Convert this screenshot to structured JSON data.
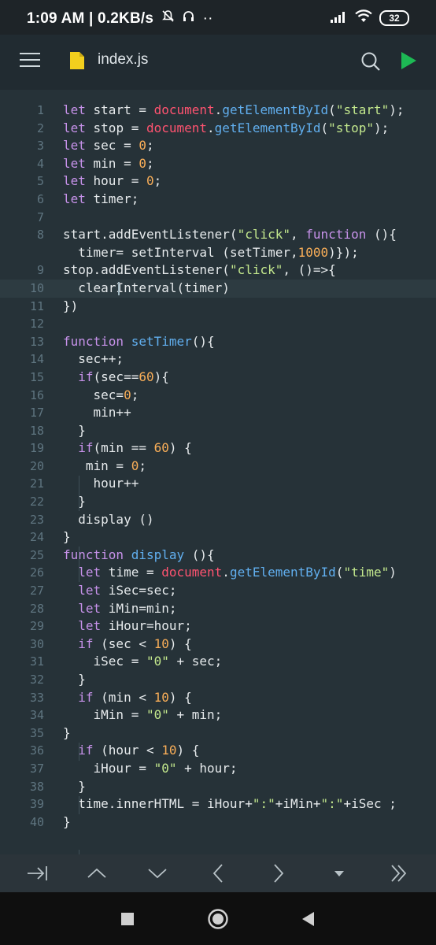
{
  "status_bar": {
    "time": "1:09 AM",
    "speed": "0.2KB/s",
    "battery": "32",
    "icons": [
      "muted-bell-icon",
      "headphones-icon",
      "more-dots-icon",
      "signal-icon",
      "wifi-icon",
      "battery-icon"
    ]
  },
  "app_bar": {
    "filename": "index.js",
    "icons": [
      "menu-icon",
      "js-file-icon",
      "search-icon",
      "run-icon"
    ]
  },
  "editor": {
    "active_line": 10,
    "line_numbers": [
      "1",
      "2",
      "3",
      "4",
      "5",
      "6",
      "7",
      "8",
      "",
      "9",
      "10",
      "11",
      "12",
      "13",
      "14",
      "15",
      "16",
      "17",
      "18",
      "19",
      "20",
      "21",
      "22",
      "23",
      "24",
      "25",
      "26",
      "27",
      "28",
      "29",
      "30",
      "31",
      "32",
      "33",
      "34",
      "35",
      "36",
      "37",
      "38",
      "39",
      "40"
    ],
    "lines": [
      "let start = document.getElementById(\"start\");",
      "let stop = document.getElementById(\"stop\");",
      "let sec = 0;",
      "let min = 0;",
      "let hour = 0;",
      "let timer;",
      "",
      "start.addEventListener(\"click\", function (){",
      "  timer= setInterval (setTimer,1000)});",
      "stop.addEventListener(\"click\", ()=>{",
      "  clearInterval(timer)",
      "})",
      "",
      "function setTimer(){",
      "  sec++;",
      "  if(sec==60){",
      "    sec=0;",
      "    min++",
      "  }",
      "  if(min == 60) {",
      "   min = 0;",
      "    hour++",
      "  }",
      "  display ()",
      "}",
      "function display (){",
      "  let time = document.getElementById(\"time\")",
      "  let iSec=sec;",
      "  let iMin=min;",
      "  let iHour=hour;",
      "  if (sec < 10) {",
      "    iSec = \"0\" + sec;",
      "  }",
      "  if (min < 10) {",
      "    iMin = \"0\" + min;",
      "}",
      "  if (hour < 10) {",
      "    iHour = \"0\" + hour;",
      "  }",
      "  time.innerHTML = iHour+\":\"+iMin+\":\"+iSec ;",
      "}"
    ]
  },
  "keyboard_bar": {
    "keys": [
      {
        "name": "tab-key",
        "icon": "tab-arrow-icon"
      },
      {
        "name": "up-key",
        "icon": "chevron-up-icon"
      },
      {
        "name": "down-key",
        "icon": "chevron-down-icon"
      },
      {
        "name": "left-key",
        "icon": "chevron-left-icon"
      },
      {
        "name": "right-key",
        "icon": "chevron-right-icon"
      },
      {
        "name": "dropdown-key",
        "icon": "caret-down-icon"
      },
      {
        "name": "end-key",
        "icon": "double-chevron-right-icon"
      }
    ]
  },
  "nav_bar": {
    "buttons": [
      "recents-square-icon",
      "home-circle-icon",
      "back-triangle-icon"
    ]
  },
  "colors": {
    "background": "#263238",
    "keyword": "#c792ea",
    "function": "#61afef",
    "string": "#c3e88d",
    "number": "#f9ae58",
    "object": "#ff5370",
    "run_accent": "#1db954",
    "js_file_icon": "#f2cf1d"
  }
}
